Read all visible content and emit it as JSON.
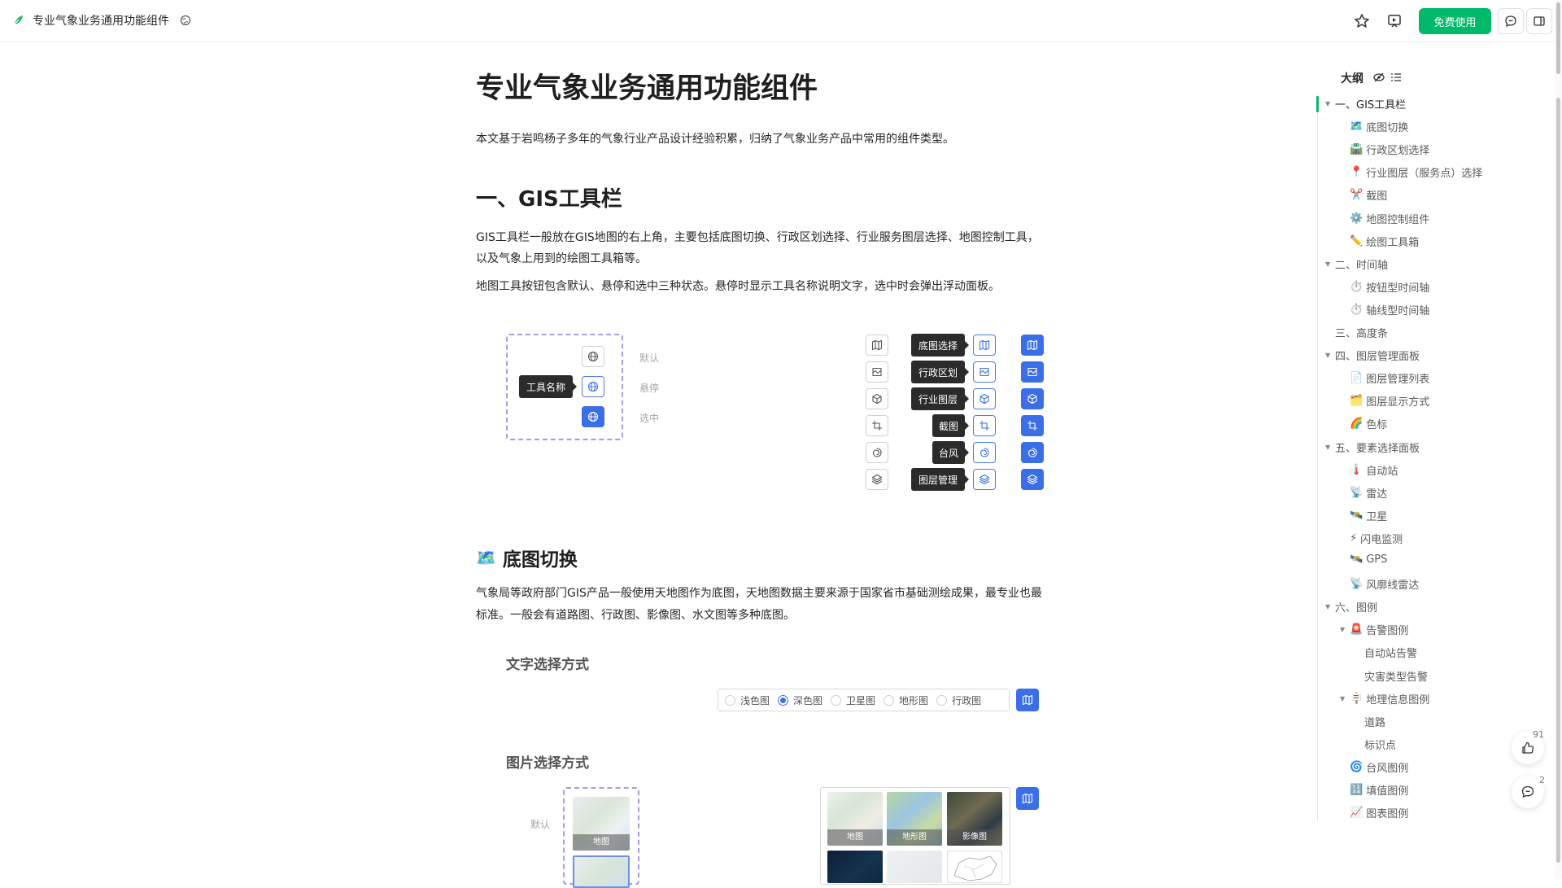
{
  "header": {
    "doc_title": "专业气象业务通用功能组件",
    "free_button": "免费使用"
  },
  "article": {
    "title": "专业气象业务通用功能组件",
    "intro": "本文基于岩鸣杨子多年的气象行业产品设计经验积累，归纳了气象业务产品中常用的组件类型。",
    "h2_gis": "一、GIS工具栏",
    "gis_p1_line1": "GIS工具栏一般放在GIS地图的右上角，主要包括底图切换、行政区划选择、行业服务图层选择、地图控制工具，",
    "gis_p1_line2": "以及气象上用到的绘图工具箱等。",
    "gis_p2": "地图工具按钮包含默认、悬停和选中三种状态。悬停时显示工具名称说明文字，选中时会弹出浮动面板。",
    "diagram1": {
      "tooltip": "工具名称",
      "states": [
        "默认",
        "悬停",
        "选中"
      ]
    },
    "diagram2": {
      "tooltips": [
        "底图选择",
        "行政区划",
        "行业图层",
        "截图",
        "台风",
        "图层管理"
      ]
    },
    "h3_basemap": "底图切换",
    "basemap_p_line1": "气象局等政府部门GIS产品一般使用天地图作为底图，天地图数据主要来源于国家省市基础测绘成果，最专业也最",
    "basemap_p_line2": "标准。一般会有道路图、行政图、影像图、水文图等多种底图。",
    "text_select_title": "文字选择方式",
    "radio_options": [
      "浅色图",
      "深色图",
      "卫星图",
      "地形图",
      "行政图"
    ],
    "radio_selected": "深色图",
    "image_select_title": "图片选择方式",
    "image_default_label": "默认",
    "default_tile_caption": "地图",
    "tiles": [
      "地图",
      "地形图",
      "影像图"
    ]
  },
  "outline": {
    "title": "大纲",
    "items": [
      {
        "label": "一、GIS工具栏",
        "level": 0,
        "caret": true,
        "emoji": ""
      },
      {
        "label": "底图切换",
        "level": 1,
        "emoji": "🗺️"
      },
      {
        "label": "行政区划选择",
        "level": 1,
        "emoji": "🛣️"
      },
      {
        "label": "行业图层（服务点）选择",
        "level": 1,
        "emoji": "📍"
      },
      {
        "label": "截图",
        "level": 1,
        "emoji": "✂️"
      },
      {
        "label": "地图控制组件",
        "level": 1,
        "emoji": "⚙️"
      },
      {
        "label": "绘图工具箱",
        "level": 1,
        "emoji": "✏️"
      },
      {
        "label": "二、时间轴",
        "level": 0,
        "caret": true,
        "emoji": ""
      },
      {
        "label": "按钮型时间轴",
        "level": 1,
        "emoji": "⏱️"
      },
      {
        "label": "轴线型时间轴",
        "level": 1,
        "emoji": "⏱️"
      },
      {
        "label": "三、高度条",
        "level": 0,
        "caret": false,
        "emoji": ""
      },
      {
        "label": "四、图层管理面板",
        "level": 0,
        "caret": true,
        "emoji": ""
      },
      {
        "label": "图层管理列表",
        "level": 1,
        "emoji": "📄"
      },
      {
        "label": "图层显示方式",
        "level": 1,
        "emoji": "🗂️"
      },
      {
        "label": "色标",
        "level": 1,
        "emoji": "🌈"
      },
      {
        "label": "五、要素选择面板",
        "level": 0,
        "caret": true,
        "emoji": ""
      },
      {
        "label": "自动站",
        "level": 1,
        "emoji": "🌡️"
      },
      {
        "label": "雷达",
        "level": 1,
        "emoji": "📡"
      },
      {
        "label": "卫星",
        "level": 1,
        "emoji": "🛰️"
      },
      {
        "label": "闪电监测",
        "level": 1,
        "emoji": "⚡"
      },
      {
        "label": "GPS",
        "level": 1,
        "emoji": "🛰️"
      },
      {
        "label": "风廓线雷达",
        "level": 1,
        "emoji": "📡"
      },
      {
        "label": "六、图例",
        "level": 0,
        "caret": true,
        "emoji": ""
      },
      {
        "label": "告警图例",
        "level": 1,
        "caret": true,
        "emoji": "🚨"
      },
      {
        "label": "自动站告警",
        "level": 2,
        "emoji": ""
      },
      {
        "label": "灾害类型告警",
        "level": 2,
        "emoji": ""
      },
      {
        "label": "地理信息图例",
        "level": 1,
        "caret": true,
        "emoji": "🪧"
      },
      {
        "label": "道路",
        "level": 2,
        "emoji": ""
      },
      {
        "label": "标识点",
        "level": 2,
        "emoji": ""
      },
      {
        "label": "台风图例",
        "level": 1,
        "emoji": "🌀"
      },
      {
        "label": "填值图例",
        "level": 1,
        "emoji": "🔢"
      },
      {
        "label": "图表图例",
        "level": 1,
        "emoji": "📈"
      }
    ]
  },
  "floats": {
    "like_count": "91",
    "comment_count": "2"
  },
  "colors": {
    "brand": "#00b96b",
    "tool_blue": "#3b6fe8",
    "dash": "#a99ae0"
  }
}
